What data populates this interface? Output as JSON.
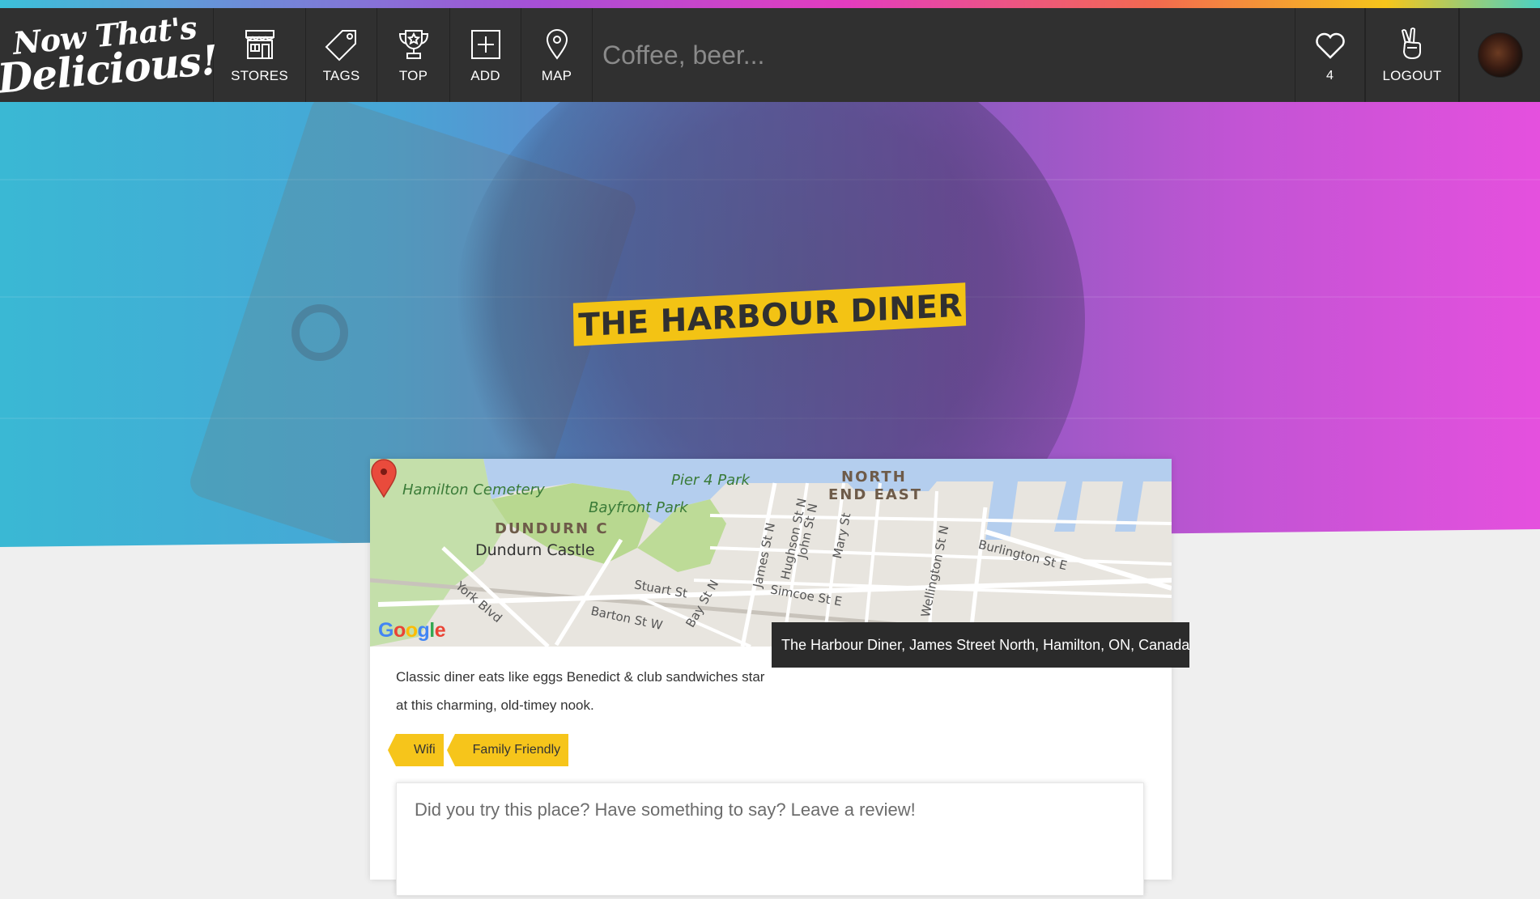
{
  "brand": {
    "line1": "Now That's",
    "line2": "Delicious!"
  },
  "nav": {
    "items": [
      {
        "label": "STORES",
        "icon": "store-icon"
      },
      {
        "label": "TAGS",
        "icon": "tag-icon"
      },
      {
        "label": "TOP",
        "icon": "trophy-icon"
      },
      {
        "label": "ADD",
        "icon": "add-icon"
      },
      {
        "label": "MAP",
        "icon": "map-pin-icon"
      }
    ],
    "search_placeholder": "Coffee, beer...",
    "hearts_count": "4",
    "logout_label": "LOGOUT"
  },
  "store": {
    "name": "THE HARBOUR DINER",
    "address_tooltip": "The Harbour Diner, James Street North, Hamilton, ON, Canada",
    "description": "Classic diner eats like eggs Benedict & club sandwiches star at this charming, old-timey nook.",
    "tags": [
      "Wifi",
      "Family Friendly"
    ]
  },
  "map": {
    "labels": {
      "hamilton_cemetery": "Hamilton Cemetery",
      "pier4": "Pier 4 Park",
      "bayfront": "Bayfront Park",
      "north_end_east_1": "NORTH",
      "north_end_east_2": "END EAST",
      "dundurn": "DUNDURN C",
      "dundurn_castle": "Dundurn Castle",
      "burlington": "Burlington St E",
      "stuart": "Stuart St",
      "barton": "Barton St W",
      "bay": "Bay St N",
      "york": "York Blvd",
      "simcoe": "Simcoe St E",
      "hughson": "Hughson St N",
      "john": "John St N",
      "mary": "Mary St",
      "wellington": "Wellington St N",
      "james": "James St N"
    }
  },
  "review": {
    "placeholder": "Did you try this place? Have something to say? Leave a review!"
  },
  "colors": {
    "accent": "#f6c51b",
    "header": "#303030"
  }
}
